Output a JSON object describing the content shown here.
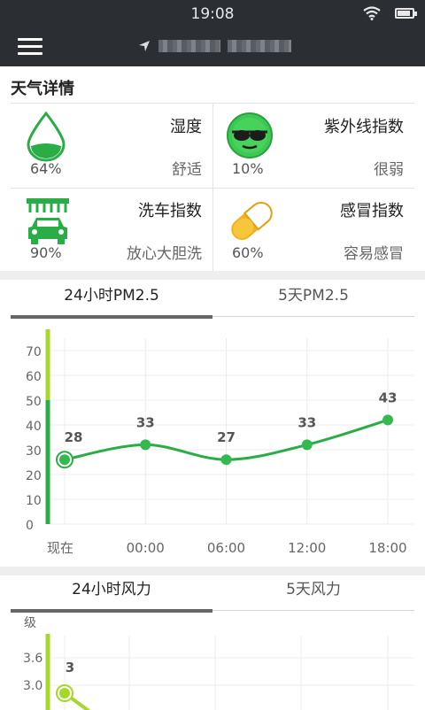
{
  "status": {
    "time": "19:08"
  },
  "details": {
    "title": "天气详情",
    "items": [
      {
        "name": "湿度",
        "value": "64%",
        "desc": "舒适",
        "icon": "humidity-drop-icon"
      },
      {
        "name": "紫外线指数",
        "value": "10%",
        "desc": "很弱",
        "icon": "sunglasses-face-icon"
      },
      {
        "name": "洗车指数",
        "value": "90%",
        "desc": "放心大胆洗",
        "icon": "car-wash-icon"
      },
      {
        "name": "感冒指数",
        "value": "60%",
        "desc": "容易感冒",
        "icon": "pill-capsule-icon"
      }
    ]
  },
  "pm_tabs": {
    "active": "24小时PM2.5",
    "inactive": "5天PM2.5"
  },
  "wind_tabs": {
    "active": "24小时风力",
    "inactive": "5天风力"
  },
  "colors": {
    "accent": "#2aac46",
    "lime": "#a6d82c",
    "dark": "#2b2f33"
  },
  "chart_data": [
    {
      "type": "line",
      "categories": [
        "现在",
        "00:00",
        "06:00",
        "12:00",
        "18:00"
      ],
      "values": [
        26,
        32,
        26,
        32,
        42
      ],
      "data_labels": [
        "28",
        "33",
        "27",
        "33",
        "43"
      ],
      "yticks": [
        "0",
        "10",
        "20",
        "30",
        "40",
        "50",
        "60",
        "70"
      ],
      "ylim": [
        0,
        75
      ],
      "grid": true
    },
    {
      "type": "line",
      "ylabel": "级",
      "yticks": [
        "3.0",
        "3.6"
      ],
      "values": [
        2.9
      ],
      "data_labels": [
        "3"
      ],
      "grid": true
    }
  ]
}
